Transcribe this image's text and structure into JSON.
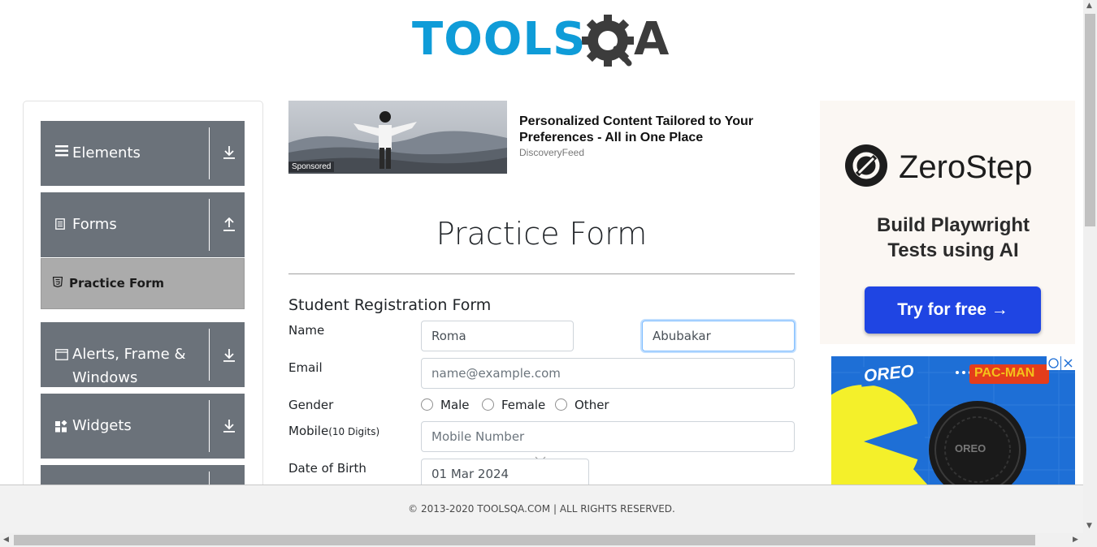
{
  "header": {
    "logo_text": "TOOLS",
    "logo_suffix": "A"
  },
  "sidebar": {
    "groups": [
      {
        "label": "Elements",
        "icon": "hamburger-icon",
        "arrow": "download-arrow-icon"
      },
      {
        "label": "Forms",
        "icon": "document-icon",
        "arrow": "upload-arrow-icon"
      },
      {
        "label": "Alerts, Frame & Windows",
        "icon": "window-icon",
        "arrow": "download-arrow-icon"
      },
      {
        "label": "Widgets",
        "icon": "widgets-icon",
        "arrow": "download-arrow-icon"
      }
    ],
    "active_item": {
      "label": "Practice Form",
      "icon": "html5-icon"
    }
  },
  "ad_banner": {
    "sponsored_label": "Sponsored",
    "title": "Personalized Content Tailored to Your Preferences - All in One Place",
    "source": "DiscoveryFeed"
  },
  "main": {
    "page_title": "Practice Form",
    "form_heading": "Student Registration Form",
    "labels": {
      "name": "Name",
      "email": "Email",
      "gender": "Gender",
      "mobile": "Mobile",
      "mobile_hint": "(10 Digits)",
      "dob": "Date of Birth"
    },
    "fields": {
      "first_name": "Roma",
      "last_name": "Abubakar",
      "email_placeholder": "name@example.com",
      "mobile_placeholder": "Mobile Number",
      "dob": "01 Mar 2024"
    },
    "gender_options": [
      "Male",
      "Female",
      "Other"
    ]
  },
  "right_ads": {
    "zerostep": {
      "brand": "ZeroStep",
      "tagline_line1": "Build Playwright",
      "tagline_line2": "Tests using AI",
      "cta": "Try for free →"
    },
    "oreo": {
      "brand": "OREO",
      "partner": "PAC-MAN",
      "cookie_text": "OREO"
    }
  },
  "footer": {
    "text": "© 2013-2020 TOOLSQA.COM | ALL RIGHTS RESERVED."
  },
  "colors": {
    "brand_blue": "#0f9cd8",
    "sidebar_group": "#6b727a",
    "active_item": "#ababab",
    "cta_blue": "#1f45e3"
  }
}
